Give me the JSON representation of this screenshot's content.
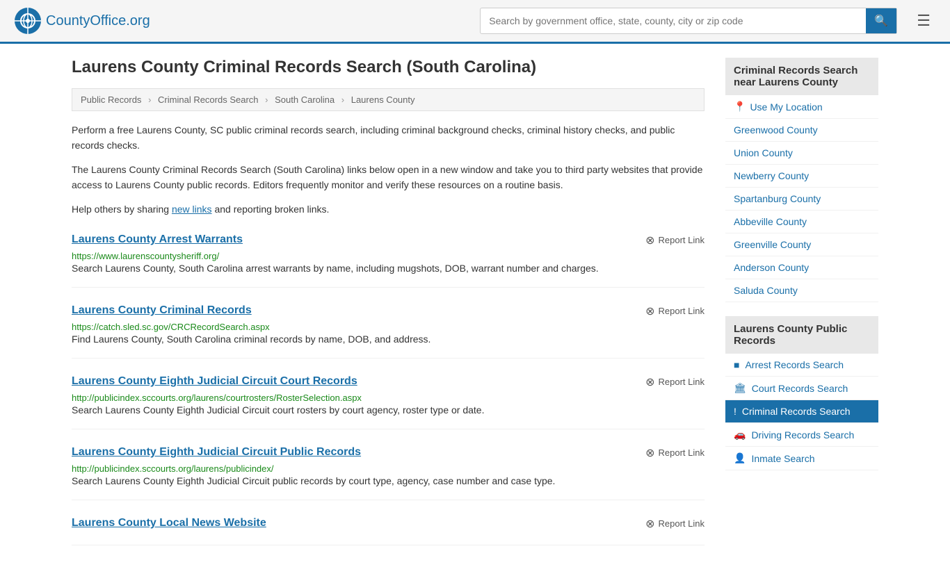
{
  "header": {
    "logo_text": "CountyOffice",
    "logo_suffix": ".org",
    "search_placeholder": "Search by government office, state, county, city or zip code",
    "search_value": ""
  },
  "page": {
    "title": "Laurens County Criminal Records Search (South Carolina)",
    "breadcrumbs": [
      {
        "label": "Public Records",
        "href": "#"
      },
      {
        "label": "Criminal Records Search",
        "href": "#"
      },
      {
        "label": "South Carolina",
        "href": "#"
      },
      {
        "label": "Laurens County",
        "href": "#"
      }
    ],
    "intro1": "Perform a free Laurens County, SC public criminal records search, including criminal background checks, criminal history checks, and public records checks.",
    "intro2": "The Laurens County Criminal Records Search (South Carolina) links below open in a new window and take you to third party websites that provide access to Laurens County public records. Editors frequently monitor and verify these resources on a routine basis.",
    "share_text_prefix": "Help others by sharing ",
    "share_link": "new links",
    "share_text_suffix": " and reporting broken links."
  },
  "results": [
    {
      "title": "Laurens County Arrest Warrants",
      "url": "https://www.laurenscountysheriff.org/",
      "desc": "Search Laurens County, South Carolina arrest warrants by name, including mugshots, DOB, warrant number and charges.",
      "report": "Report Link"
    },
    {
      "title": "Laurens County Criminal Records",
      "url": "https://catch.sled.sc.gov/CRCRecordSearch.aspx",
      "desc": "Find Laurens County, South Carolina criminal records by name, DOB, and address.",
      "report": "Report Link"
    },
    {
      "title": "Laurens County Eighth Judicial Circuit Court Records",
      "url": "http://publicindex.sccourts.org/laurens/courtrosters/RosterSelection.aspx",
      "desc": "Search Laurens County Eighth Judicial Circuit court rosters by court agency, roster type or date.",
      "report": "Report Link"
    },
    {
      "title": "Laurens County Eighth Judicial Circuit Public Records",
      "url": "http://publicindex.sccourts.org/laurens/publicindex/",
      "desc": "Search Laurens County Eighth Judicial Circuit public records by court type, agency, case number and case type.",
      "report": "Report Link"
    },
    {
      "title": "Laurens County Local News Website",
      "url": "",
      "desc": "",
      "report": "Report Link"
    }
  ],
  "sidebar": {
    "nearby_header": "Criminal Records Search near Laurens County",
    "use_my_location": "Use My Location",
    "nearby_counties": [
      "Greenwood County",
      "Union County",
      "Newberry County",
      "Spartanburg County",
      "Abbeville County",
      "Greenville County",
      "Anderson County",
      "Saluda County"
    ],
    "public_records_header": "Laurens County Public Records",
    "public_records": [
      {
        "label": "Arrest Records Search",
        "icon": "■",
        "active": false
      },
      {
        "label": "Court Records Search",
        "icon": "🏛",
        "active": false
      },
      {
        "label": "Criminal Records Search",
        "icon": "!",
        "active": true
      },
      {
        "label": "Driving Records Search",
        "icon": "🚗",
        "active": false
      },
      {
        "label": "Inmate Search",
        "icon": "👤",
        "active": false
      }
    ]
  }
}
